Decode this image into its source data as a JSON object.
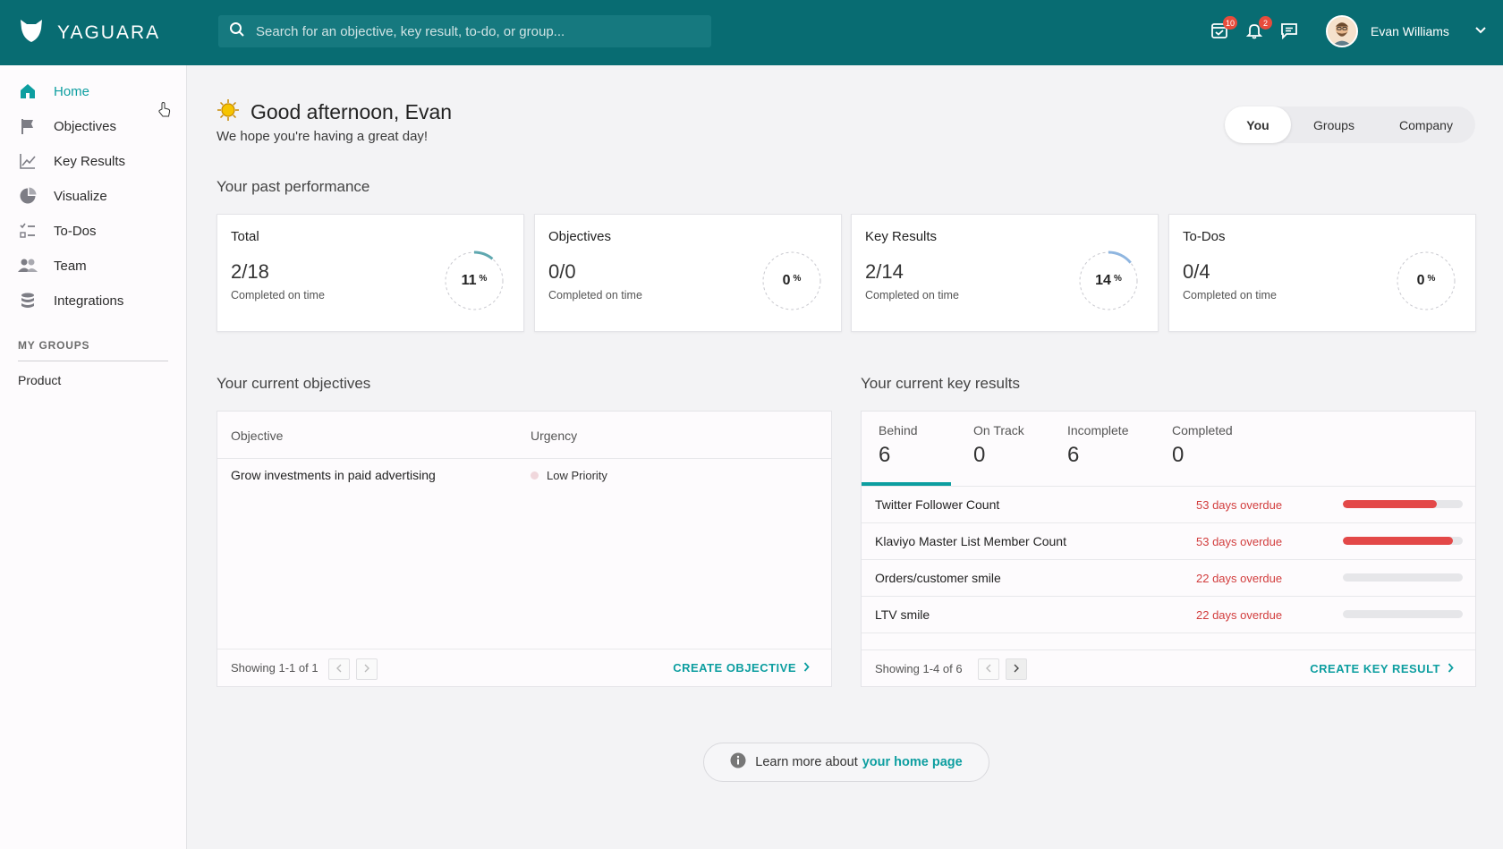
{
  "app": {
    "brand": "YAGUARA"
  },
  "search": {
    "placeholder": "Search for an objective, key result, to-do, or group..."
  },
  "topbar": {
    "tasks_badge": "10",
    "notifications_badge": "2",
    "user_name": "Evan Williams"
  },
  "sidebar": {
    "items": [
      {
        "label": "Home",
        "icon": "home-icon"
      },
      {
        "label": "Objectives",
        "icon": "flag-icon"
      },
      {
        "label": "Key Results",
        "icon": "line-chart-icon"
      },
      {
        "label": "Visualize",
        "icon": "pie-chart-icon"
      },
      {
        "label": "To-Dos",
        "icon": "checklist-icon"
      },
      {
        "label": "Team",
        "icon": "people-icon"
      },
      {
        "label": "Integrations",
        "icon": "database-icon"
      }
    ],
    "groups_title": "MY GROUPS",
    "groups": [
      "Product"
    ]
  },
  "greeting": {
    "title": "Good afternoon, Evan",
    "subtitle": "We hope you're having a great day!"
  },
  "scope_tabs": [
    "You",
    "Groups",
    "Company"
  ],
  "performance": {
    "title": "Your past performance",
    "cards": [
      {
        "label": "Total",
        "value": "2/18",
        "sub": "Completed on time",
        "percent": 11,
        "percent_text": "11"
      },
      {
        "label": "Objectives",
        "value": "0/0",
        "sub": "Completed on time",
        "percent": 0,
        "percent_text": "0"
      },
      {
        "label": "Key Results",
        "value": "2/14",
        "sub": "Completed on time",
        "percent": 14,
        "percent_text": "14"
      },
      {
        "label": "To-Dos",
        "value": "0/4",
        "sub": "Completed on time",
        "percent": 0,
        "percent_text": "0"
      }
    ],
    "percent_sign": "%"
  },
  "objectives": {
    "title": "Your current objectives",
    "col_objective": "Objective",
    "col_urgency": "Urgency",
    "rows": [
      {
        "name": "Grow investments in paid advertising",
        "urgency": "Low Priority"
      }
    ],
    "showing": "Showing 1-1 of 1",
    "create": "CREATE OBJECTIVE"
  },
  "key_results": {
    "title": "Your current key results",
    "tabs": [
      {
        "label": "Behind",
        "count": "6"
      },
      {
        "label": "On Track",
        "count": "0"
      },
      {
        "label": "Incomplete",
        "count": "6"
      },
      {
        "label": "Completed",
        "count": "0"
      }
    ],
    "rows": [
      {
        "name": "Twitter Follower Count",
        "status": "53 days overdue",
        "progress": 0.78
      },
      {
        "name": "Klaviyo Master List Member Count",
        "status": "53 days overdue",
        "progress": 0.92
      },
      {
        "name": "Orders/customer smile",
        "status": "22 days overdue",
        "progress": 0
      },
      {
        "name": "LTV smile",
        "status": "22 days overdue",
        "progress": 0
      }
    ],
    "showing": "Showing 1-4 of 6",
    "create": "CREATE KEY RESULT"
  },
  "learn_more": {
    "prefix": "Learn more about",
    "link": "your home page"
  },
  "colors": {
    "brand": "#086c72",
    "accent": "#0d9ea0",
    "overdue": "#d23d3d"
  }
}
